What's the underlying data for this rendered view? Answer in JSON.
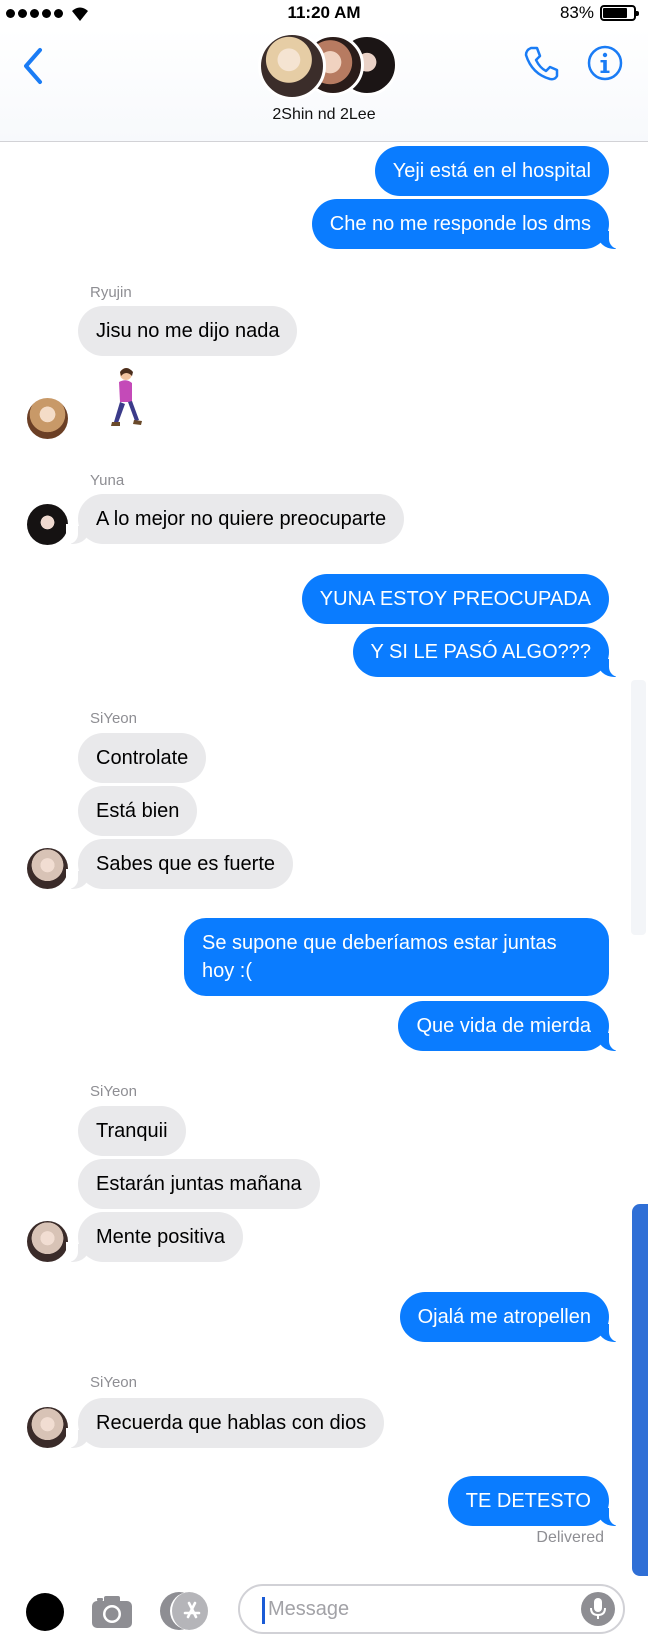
{
  "status_bar": {
    "time": "11:20 AM",
    "battery": "83%"
  },
  "header": {
    "group_name": "2Shin nd 2Lee",
    "back_icon": "chevron-left-icon",
    "call_icon": "phone-icon",
    "info_icon": "info-icon"
  },
  "senders": {
    "ryujin": "Ryujin",
    "yuna": "Yuna",
    "siyeon1": "SiYeon",
    "siyeon2": "SiYeon",
    "siyeon3": "SiYeon"
  },
  "messages": {
    "m1": "Yeji está en el hospital",
    "m2": "Che no me responde los dms",
    "m3": "Jisu no me dijo nada",
    "m4": "🚶‍♀️",
    "m5": "A lo mejor no quiere preocuparte",
    "m6": "YUNA ESTOY PREOCUPADA",
    "m7": "Y SI LE PASÓ ALGO???",
    "m8": "Controlate",
    "m9": "Está bien",
    "m10": "Sabes que es fuerte",
    "m11": "Se supone que deberíamos estar juntas hoy :(",
    "m12": "Que vida de mierda",
    "m13": "Tranquii",
    "m14": "Estarán juntas mañana",
    "m15": "Mente positiva",
    "m16": "Ojalá me atropellen",
    "m17": "Recuerda que hablas con dios",
    "m18": "TE DETESTO"
  },
  "delivered": "Delivered",
  "input": {
    "placeholder": "Message"
  },
  "colors": {
    "sent_bubble": "#0a7cff",
    "received_bubble": "#e9e9eb",
    "accent": "#1a7cf5"
  }
}
